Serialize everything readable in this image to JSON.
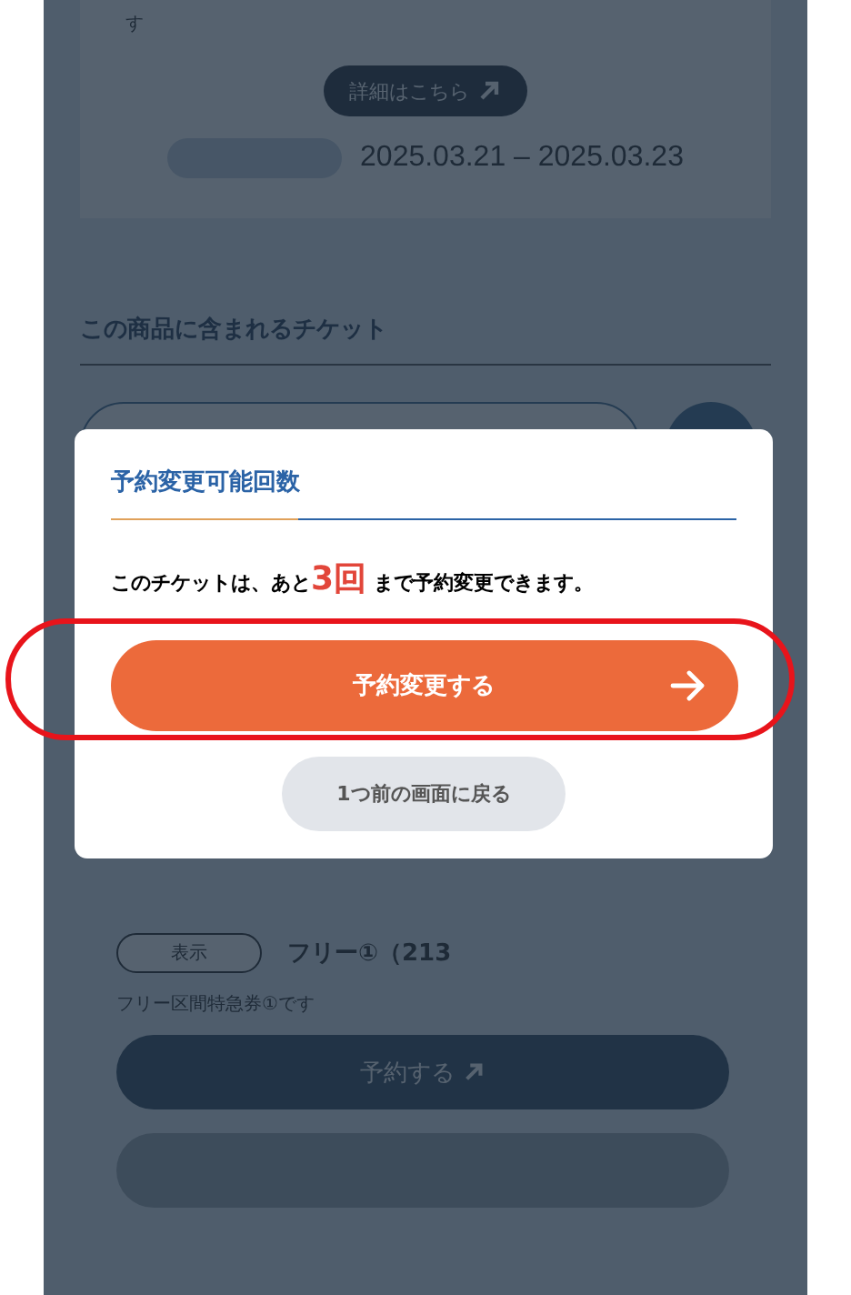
{
  "background_page": {
    "intro_fragment": "す",
    "detail_link": "詳細はこちら",
    "date_range": "2025.03.21 – 2025.03.23",
    "tickets_heading": "この商品に含まれるチケット",
    "ticket": {
      "show_button": "表示",
      "name": "フリー①（213",
      "description": "フリー区間特急券①です",
      "reserve_button": "予約する"
    }
  },
  "dialog": {
    "title": "予約変更可能回数",
    "message_before": "このチケットは、あと",
    "count": "3回",
    "message_after": "まで予約変更できます。",
    "primary_button": "予約変更する",
    "secondary_button": "1つ前の画面に戻る",
    "primary_highlighted": true
  }
}
